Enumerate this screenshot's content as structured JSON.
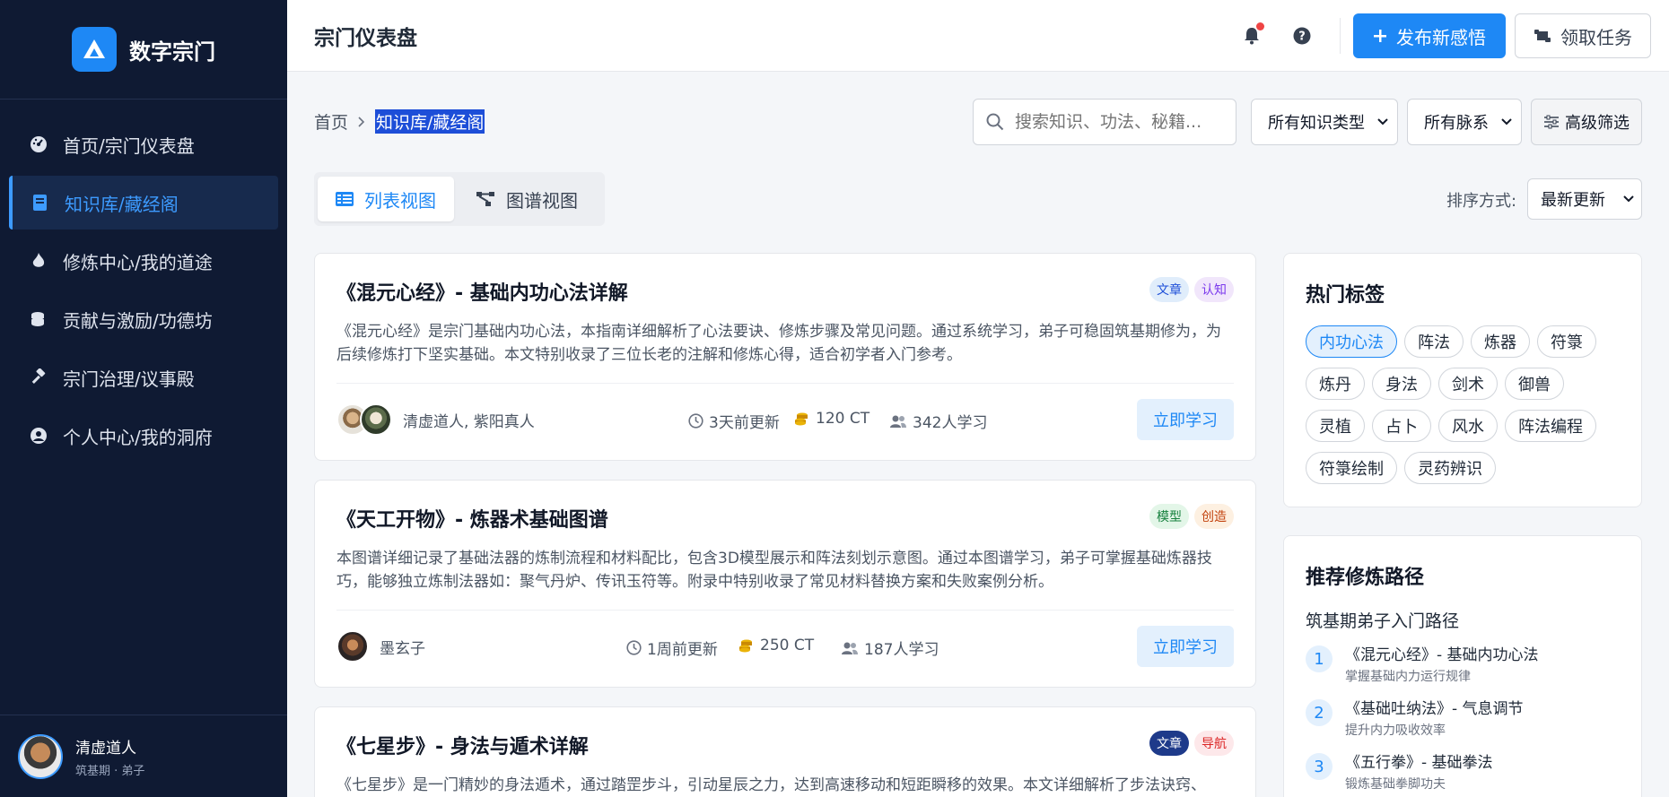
{
  "brand": {
    "name": "数字宗门"
  },
  "sidebar": {
    "items": [
      {
        "label": "首页/宗门仪表盘",
        "icon": "dashboard-icon"
      },
      {
        "label": "知识库/藏经阁",
        "icon": "book-icon"
      },
      {
        "label": "修炼中心/我的道途",
        "icon": "flame-icon"
      },
      {
        "label": "贡献与激励/功德坊",
        "icon": "coins-icon"
      },
      {
        "label": "宗门治理/议事殿",
        "icon": "gavel-icon"
      },
      {
        "label": "个人中心/我的洞府",
        "icon": "user-circle-icon"
      }
    ],
    "active_index": 1
  },
  "user": {
    "name": "清虚道人",
    "role": "筑基期 · 弟子"
  },
  "topbar": {
    "title": "宗门仪表盘",
    "publish_label": "发布新感悟",
    "task_label": "领取任务"
  },
  "breadcrumb": {
    "home": "首页",
    "current": "知识库/藏经阁"
  },
  "filters": {
    "search_placeholder": "搜索知识、功法、秘籍...",
    "type_select": "所有知识类型",
    "lineage_select": "所有脉系",
    "advanced_label": "高级筛选"
  },
  "view": {
    "list_label": "列表视图",
    "graph_label": "图谱视图",
    "active": "list"
  },
  "sort": {
    "label": "排序方式:",
    "value": "最新更新"
  },
  "cards": [
    {
      "title": "《混元心经》- 基础内功心法详解",
      "tags": [
        {
          "label": "文章",
          "bg": "#e0edfb",
          "fg": "#1d4ed8"
        },
        {
          "label": "认知",
          "bg": "#f1e6fb",
          "fg": "#7c3aed"
        }
      ],
      "desc": "《混元心经》是宗门基础内功心法，本指南详细解析了心法要诀、修炼步骤及常见问题。通过系统学习，弟子可稳固筑基期修为，为后续修炼打下坚实基础。本文特别收录了三位长老的注解和修炼心得，适合初学者入门参考。",
      "authors": "清虚道人, 紫阳真人",
      "updated": "3天前更新",
      "ct": "120 CT",
      "learners": "342人学习",
      "button": "立即学习"
    },
    {
      "title": "《天工开物》- 炼器术基础图谱",
      "tags": [
        {
          "label": "模型",
          "bg": "#e3f6e8",
          "fg": "#15803d"
        },
        {
          "label": "创造",
          "bg": "#fdf0e1",
          "fg": "#c2410c"
        }
      ],
      "desc": "本图谱详细记录了基础法器的炼制流程和材料配比，包含3D模型展示和阵法刻划示意图。通过本图谱学习，弟子可掌握基础炼器技巧，能够独立炼制法器如：聚气丹炉、传讯玉符等。附录中特别收录了常见材料替换方案和失败案例分析。",
      "authors": "墨玄子",
      "updated": "1周前更新",
      "ct": "250 CT",
      "learners": "187人学习",
      "button": "立即学习"
    },
    {
      "title": "《七星步》- 身法与遁术详解",
      "tags": [
        {
          "label": "文章",
          "bg": "#1e3a8a",
          "fg": "#ffffff"
        },
        {
          "label": "导航",
          "bg": "#fde8ea",
          "fg": "#dc2626"
        }
      ],
      "desc": "《七星步》是一门精妙的身法遁术，通过踏罡步斗，引动星辰之力，达到高速移动和短距瞬移的效果。本文详细解析了步法诀窍、"
    }
  ],
  "hot_tags": {
    "title": "热门标签",
    "items": [
      "内功心法",
      "阵法",
      "炼器",
      "符箓",
      "炼丹",
      "身法",
      "剑术",
      "御兽",
      "灵植",
      "占卜",
      "风水",
      "阵法编程",
      "符箓绘制",
      "灵药辨识"
    ],
    "active_index": 0
  },
  "path": {
    "title": "推荐修炼路径",
    "subtitle": "筑基期弟子入门路径",
    "steps": [
      {
        "num": "1",
        "title": "《混元心经》- 基础内功心法",
        "sub": "掌握基础内力运行规律"
      },
      {
        "num": "2",
        "title": "《基础吐纳法》- 气息调节",
        "sub": "提升内力吸收效率"
      },
      {
        "num": "3",
        "title": "《五行拳》- 基础拳法",
        "sub": "锻炼基础拳脚功夫"
      }
    ]
  },
  "colors": {
    "sidebar_bg": "#0f1a33",
    "accent": "#1e88f5",
    "active_nav_bg": "#172a4d"
  }
}
